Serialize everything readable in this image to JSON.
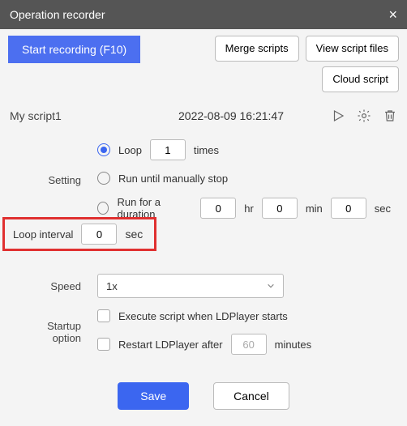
{
  "window": {
    "title": "Operation recorder"
  },
  "toolbar": {
    "start_recording": "Start recording (F10)",
    "merge": "Merge scripts",
    "view_files": "View script files",
    "cloud": "Cloud script"
  },
  "script": {
    "name": "My script1",
    "date": "2022-08-09 16:21:47"
  },
  "setting": {
    "label": "Setting",
    "loop_label": "Loop",
    "loop_value": "1",
    "times_label": "times",
    "run_manual": "Run until manually stop",
    "run_duration": "Run for a duration",
    "hr_val": "0",
    "hr_label": "hr",
    "min_val": "0",
    "min_label": "min",
    "sec_val": "0",
    "sec_label": "sec"
  },
  "loop_interval": {
    "label": "Loop interval",
    "value": "0",
    "unit": "sec"
  },
  "speed": {
    "label": "Speed",
    "value": "1x"
  },
  "startup": {
    "label": "Startup option",
    "execute": "Execute script when LDPlayer starts",
    "restart": "Restart LDPlayer after",
    "restart_val": "60",
    "restart_unit": "minutes"
  },
  "footer": {
    "save": "Save",
    "cancel": "Cancel"
  }
}
